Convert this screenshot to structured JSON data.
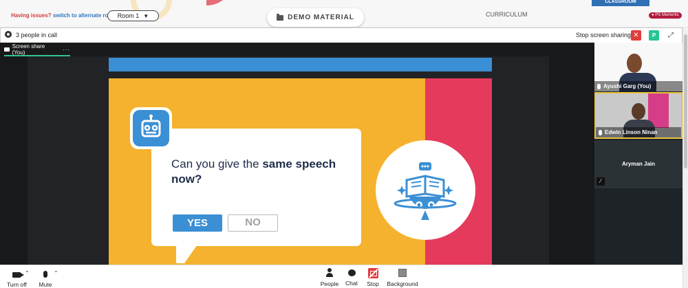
{
  "topbar": {
    "issues_question": "Having issues?",
    "issues_link": "switch to alternate room",
    "room_select_value": "Room 1",
    "demo_material_label": "DEMO MATERIAL",
    "curriculum_label": "CURRICULUM",
    "classroom_tab_label": "CLASSROOM",
    "ps_moments_label": "PS Moments"
  },
  "callbar": {
    "people_count": "3 people in call",
    "stop_screen_sharing": "Stop screen sharing",
    "close_label": "✕",
    "p_label": "P",
    "expand_label": "⤢"
  },
  "stage": {
    "share_tab_label": "Screen share (You)",
    "more_label": "···"
  },
  "slide": {
    "question_prefix": "Can you give the",
    "question_bold": "same speech",
    "question_suffix": "now?",
    "yes_label": "YES",
    "no_label": "NO"
  },
  "participants": [
    {
      "name": "Ayushi Garg (You)"
    },
    {
      "name": "Edwin Linson Ninan"
    },
    {
      "name": "Aryman Jain"
    }
  ],
  "bottombar": {
    "turn_off_label": "Turn off",
    "mute_label": "Mute",
    "people_label": "People",
    "chat_label": "Chat",
    "stop_label": "Stop",
    "background_label": "Background"
  },
  "colors": {
    "slide_yellow": "#f5b22e",
    "slide_red": "#e53a5c",
    "slide_blue": "#3b8fd4",
    "active_green": "#31c48d",
    "stop_red": "#e23c3c"
  }
}
